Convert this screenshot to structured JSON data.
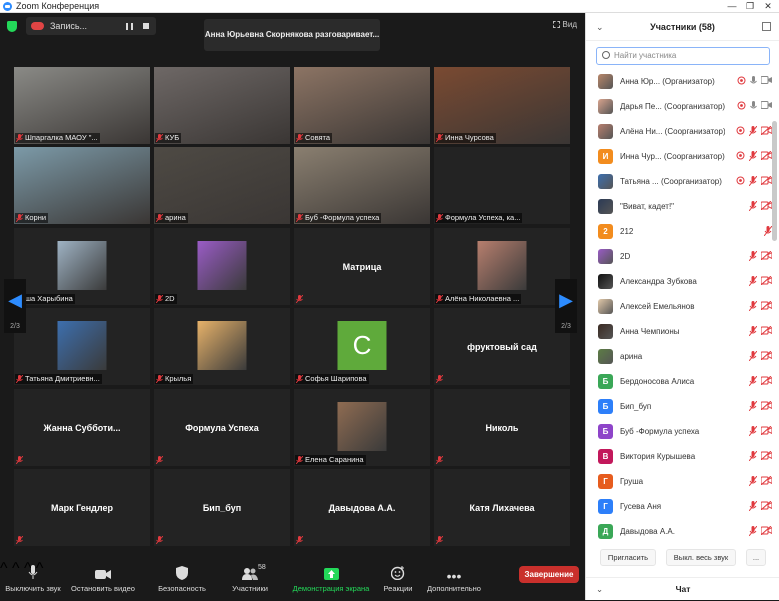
{
  "window": {
    "title": "Zoom Конференция",
    "min": "—",
    "max": "❐",
    "close": "✕"
  },
  "top": {
    "recording": "Запись...",
    "speaking": "Анна Юрьевна Скорнякова разговаривает...",
    "view": "Вид"
  },
  "tiles": [
    {
      "name": "Шпаргалка МАОУ \"...",
      "kind": "video",
      "bg": "#8a8a86"
    },
    {
      "name": "КУБ",
      "kind": "video",
      "bg": "#6e6866"
    },
    {
      "name": "Совята",
      "kind": "video",
      "bg": "#8c7464"
    },
    {
      "name": "Инна Чурсова",
      "kind": "video",
      "bg": "#7a4a32"
    },
    {
      "name": "Корни",
      "kind": "video",
      "bg": "#7c9aa8"
    },
    {
      "name": "арина",
      "kind": "video",
      "bg": "#4e4a44"
    },
    {
      "name": "Буб -Формула успеха",
      "kind": "video",
      "bg": "#8a7f70"
    },
    {
      "name": "Формула Успеха, ка...",
      "kind": "blank"
    },
    {
      "name": "ша Харыбина",
      "kind": "avatar",
      "bg": "#9fb3c4"
    },
    {
      "name": "2D",
      "kind": "avatar",
      "bg": "#9a5cc6"
    },
    {
      "name": "Матрица",
      "kind": "name",
      "label": ""
    },
    {
      "name": "Алёна Николаевна ...",
      "kind": "avatar",
      "bg": "#b77f6e"
    },
    {
      "name": "Татьяна Дмитриевн...",
      "kind": "avatar",
      "bg": "#3d6fae"
    },
    {
      "name": "Крылья",
      "kind": "avatar",
      "bg": "#e7b26a"
    },
    {
      "name": "Софья Шарипова",
      "kind": "letter",
      "letter": "С",
      "bg": "#5faa3b"
    },
    {
      "name": "фруктовый сад",
      "kind": "name",
      "label": ""
    },
    {
      "name": "Жанна  Субботи...",
      "kind": "name",
      "label": ""
    },
    {
      "name": "Формула Успеха",
      "kind": "name",
      "label": ""
    },
    {
      "name": "Елена Саранина",
      "kind": "avatar",
      "bg": "#8f6c52"
    },
    {
      "name": "Николь",
      "kind": "name",
      "label": ""
    },
    {
      "name": "Марк Гендлер",
      "kind": "name",
      "label": ""
    },
    {
      "name": "Бип_буп",
      "kind": "name",
      "label": ""
    },
    {
      "name": "Давыдова А.А.",
      "kind": "name",
      "label": ""
    },
    {
      "name": "Катя Лихачева",
      "kind": "name",
      "label": ""
    }
  ],
  "nav": {
    "left_page": "2/3",
    "right_page": "2/3"
  },
  "toolbar": {
    "mute": "Выключить звук",
    "video": "Остановить видео",
    "security": "Безопасность",
    "participants": "Участники",
    "participants_count": "58",
    "share": "Демонстрация экрана",
    "reactions": "Реакции",
    "more": "Дополнительно",
    "end": "Завершение"
  },
  "panel": {
    "title": "Участники (58)",
    "search_placeholder": "Найти участника",
    "invite": "Пригласить",
    "mute_all": "Выкл. весь звук",
    "more": "...",
    "chat": "Чат",
    "participants": [
      {
        "name": "Анна Юр... (Организатор)",
        "avatar": "img",
        "color": "#b8876a",
        "letter": ""
      },
      {
        "name": "Дарья Пе... (Соорганизатор)",
        "avatar": "img",
        "color": "#d9a48e",
        "letter": ""
      },
      {
        "name": "Алёна Ни... (Соорганизатор)",
        "avatar": "img",
        "color": "#b77f6e",
        "letter": ""
      },
      {
        "name": "Инна Чур... (Соорганизатор)",
        "avatar": "letter",
        "color": "#f28c1e",
        "letter": "И"
      },
      {
        "name": "Татьяна ... (Соорганизатор)",
        "avatar": "img",
        "color": "#3d6fae",
        "letter": ""
      },
      {
        "name": "\"Виват, кадет!\"",
        "avatar": "img",
        "color": "#2b3a55",
        "letter": ""
      },
      {
        "name": "212",
        "avatar": "letter",
        "color": "#f28c1e",
        "letter": "2"
      },
      {
        "name": "2D",
        "avatar": "img",
        "color": "#9a5cc6",
        "letter": ""
      },
      {
        "name": "Александра Зубкова",
        "avatar": "img",
        "color": "#111111",
        "letter": ""
      },
      {
        "name": "Алексей Емельянов",
        "avatar": "img",
        "color": "#e2c9a9",
        "letter": ""
      },
      {
        "name": "Анна Чемпионы",
        "avatar": "img",
        "color": "#3a2a22",
        "letter": ""
      },
      {
        "name": "арина",
        "avatar": "img",
        "color": "#5d7d45",
        "letter": ""
      },
      {
        "name": "Бердоносова Алиса",
        "avatar": "letter",
        "color": "#3aa757",
        "letter": "Б"
      },
      {
        "name": "Бип_буп",
        "avatar": "letter",
        "color": "#2d7ff9",
        "letter": "Б"
      },
      {
        "name": "Буб -Формула успеха",
        "avatar": "letter",
        "color": "#8e44c9",
        "letter": "Б"
      },
      {
        "name": "Виктория Курышева",
        "avatar": "letter",
        "color": "#c2185b",
        "letter": "В"
      },
      {
        "name": "Груша",
        "avatar": "letter",
        "color": "#e65c1e",
        "letter": "Г"
      },
      {
        "name": "Гусева Аня",
        "avatar": "letter",
        "color": "#2d7ff9",
        "letter": "Г"
      },
      {
        "name": "Давыдова А.А.",
        "avatar": "letter",
        "color": "#3aa757",
        "letter": "Д"
      }
    ]
  },
  "colors": {
    "accent": "#2d8cff",
    "muted": "#e0393e",
    "end": "#c9302c",
    "share": "#23d959"
  }
}
